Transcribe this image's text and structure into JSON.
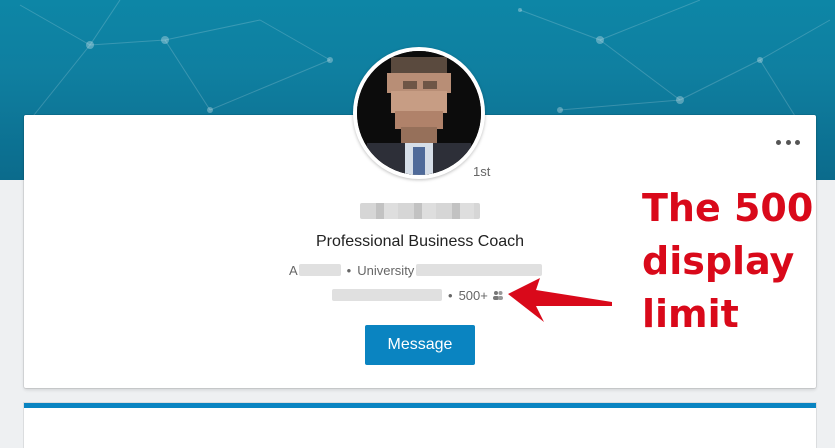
{
  "profile": {
    "degree": "1st",
    "headline": "Professional Business Coach",
    "location_prefix": "A",
    "school_prefix": "University",
    "separator": "•",
    "connections": "500+",
    "action_label": "Message"
  },
  "annotation": {
    "lines": [
      "The 500",
      "display",
      "limit"
    ]
  },
  "icons": {
    "more": "more-horizontal-icon",
    "connections": "people-icon",
    "arrow": "red-arrow-icon"
  },
  "colors": {
    "banner": "#0f7fa0",
    "primary_button": "#0a84c1",
    "annotation": "#d9091a"
  }
}
